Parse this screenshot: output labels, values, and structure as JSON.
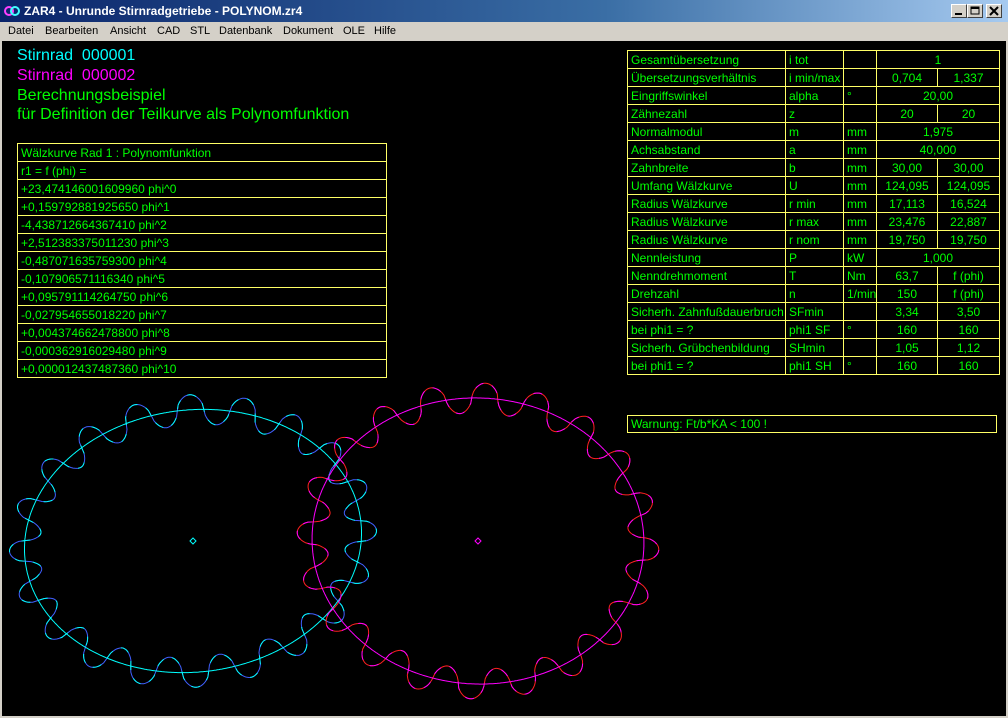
{
  "window": {
    "title": "ZAR4 - Unrunde Stirnradgetriebe  -  POLYNOM.zr4",
    "min_label": "minimize",
    "max_label": "maximize",
    "close_label": "close"
  },
  "menu": [
    "Datei",
    "Bearbeiten",
    "Ansicht",
    "CAD",
    "STL",
    "Datenbank",
    "Dokument",
    "OLE",
    "Hilfe"
  ],
  "header": {
    "gear1_label": "Stirnrad",
    "gear1_id": "000001",
    "gear2_label": "Stirnrad",
    "gear2_id": "000002",
    "desc_line1": "Berechnungsbeispiel",
    "desc_line2": "für Definition der Teilkurve als Polynomfunktion"
  },
  "polynomial": {
    "title": "Wälzkurve Rad 1 : Polynomfunktion",
    "formula": "r1 = f (phi) =",
    "terms": [
      "+23,474146001609960 phi^0",
      "+0,159792881925650 phi^1",
      "-4,438712664367410 phi^2",
      "+2,512383375011230 phi^3",
      "-0,487071635759300 phi^4",
      "-0,107906571116340 phi^5",
      "+0,095791114264750 phi^6",
      "-0,027954655018220 phi^7",
      "+0,004374662478800 phi^8",
      "-0,000362916029480 phi^9",
      "+0,000012437487360 phi^10"
    ]
  },
  "results": [
    {
      "name": "Gesamtübersetzung",
      "sym": "i tot",
      "unit": "",
      "span": "1"
    },
    {
      "name": "Übersetzungsverhältnis",
      "sym": "i min/max",
      "unit": "",
      "v1": "0,704",
      "v2": "1,337"
    },
    {
      "name": "Eingriffswinkel",
      "sym": "alpha",
      "unit": "°",
      "span": "20,00"
    },
    {
      "name": "Zähnezahl",
      "sym": "z",
      "unit": "",
      "v1": "20",
      "v2": "20"
    },
    {
      "name": "Normalmodul",
      "sym": "m",
      "unit": "mm",
      "span": "1,975"
    },
    {
      "name": "Achsabstand",
      "sym": "a",
      "unit": "mm",
      "span": "40,000"
    },
    {
      "name": "Zahnbreite",
      "sym": "b",
      "unit": "mm",
      "v1": "30,00",
      "v2": "30,00"
    },
    {
      "name": "Umfang Wälzkurve",
      "sym": "U",
      "unit": "mm",
      "v1": "124,095",
      "v2": "124,095"
    },
    {
      "name": "Radius Wälzkurve",
      "sym": "r min",
      "unit": "mm",
      "v1": "17,113",
      "v2": "16,524"
    },
    {
      "name": "Radius Wälzkurve",
      "sym": "r max",
      "unit": "mm",
      "v1": "23,476",
      "v2": "22,887"
    },
    {
      "name": "Radius Wälzkurve",
      "sym": "r nom",
      "unit": "mm",
      "v1": "19,750",
      "v2": "19,750"
    },
    {
      "name": "Nennleistung",
      "sym": "P",
      "unit": "kW",
      "span": "1,000"
    },
    {
      "name": "Nenndrehmoment",
      "sym": "T",
      "unit": "Nm",
      "v1": "63,7",
      "v2": "f (phi)"
    },
    {
      "name": "Drehzahl",
      "sym": "n",
      "unit": "1/min",
      "v1": "150",
      "v2": "f (phi)"
    },
    {
      "name": "Sicherh. Zahnfußdauerbruch",
      "sym": "SFmin",
      "unit": "",
      "v1": "3,34",
      "v2": "3,50"
    },
    {
      "name": "bei phi1 = ?",
      "sym": "phi1 SF",
      "unit": "°",
      "v1": "160",
      "v2": "160"
    },
    {
      "name": "Sicherh. Grübchenbildung",
      "sym": "SHmin",
      "unit": "",
      "v1": "1,05",
      "v2": "1,12"
    },
    {
      "name": "bei phi1 = ?",
      "sym": "phi1 SH",
      "unit": "°",
      "v1": "160",
      "v2": "160"
    }
  ],
  "warning": "Warnung: Ft/b*KA < 100 !",
  "colors": {
    "gear1_header": "#00ffff",
    "gear2_header": "#ff00ff",
    "desc": "#00ff00",
    "gear1_pitch": "#00ffff",
    "gear1_flank": "#4060ff",
    "gear2_pitch": "#ff00ff",
    "gear2_flank": "#ff2020"
  }
}
